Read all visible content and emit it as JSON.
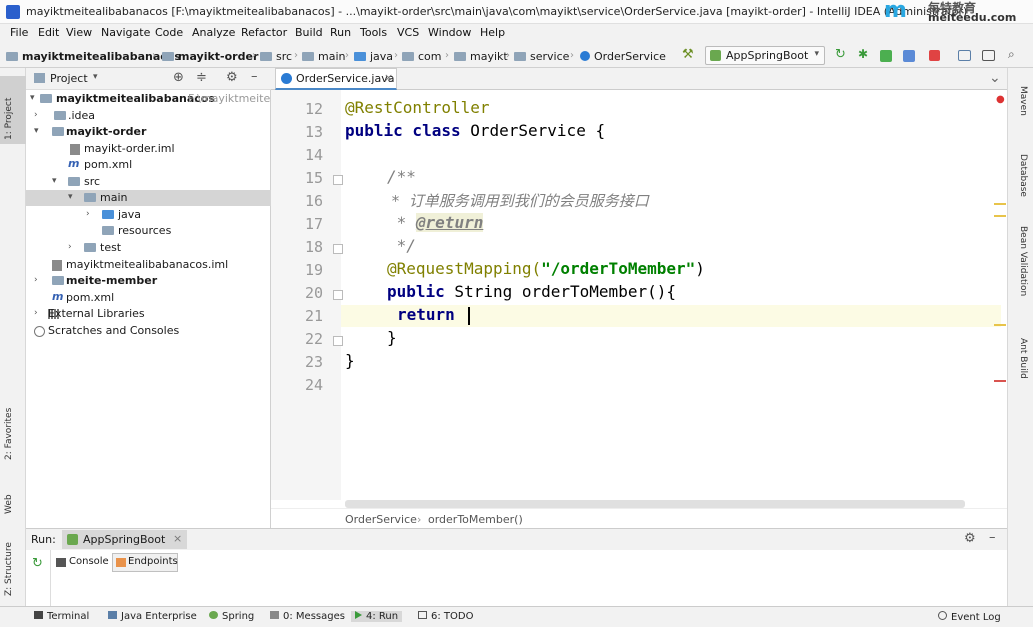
{
  "title_bar": {
    "text": "mayiktmeitealibabanacos [F:\\mayiktmeitealibabanacos] - ...\\mayikt-order\\src\\main\\java\\com\\mayikt\\service\\OrderService.java [mayikt-order] - IntelliJ IDEA (Administrator)",
    "logo_text": "meiteedu.com",
    "logo_cn": "每特教育"
  },
  "menu": [
    "File",
    "Edit",
    "View",
    "Navigate",
    "Code",
    "Analyze",
    "Refactor",
    "Build",
    "Run",
    "Tools",
    "VCS",
    "Window",
    "Help"
  ],
  "breadcrumbs": [
    "mayiktmeitealibabanacos",
    "mayikt-order",
    "src",
    "main",
    "java",
    "com",
    "mayikt",
    "service",
    "OrderService"
  ],
  "run_config": "AppSpringBoot",
  "left_tabs": [
    "1: Project",
    "2: Favorites",
    "Web",
    "Z: Structure"
  ],
  "right_tabs": [
    "Maven",
    "Database",
    "Bean Validation",
    "Ant Build"
  ],
  "project": {
    "header": "Project",
    "tree": [
      {
        "label": "mayiktmeitealibabanacos",
        "suffix": "F:\\mayiktmeiteal",
        "bold": true
      },
      {
        "label": ".idea"
      },
      {
        "label": "mayikt-order",
        "bold": true
      },
      {
        "label": "mayikt-order.iml"
      },
      {
        "label": "pom.xml"
      },
      {
        "label": "src"
      },
      {
        "label": "main"
      },
      {
        "label": "java"
      },
      {
        "label": "resources"
      },
      {
        "label": "test"
      },
      {
        "label": "mayiktmeitealibabanacos.iml"
      },
      {
        "label": "meite-member",
        "bold": true
      },
      {
        "label": "pom.xml"
      },
      {
        "label": "External Libraries"
      },
      {
        "label": "Scratches and Consoles"
      }
    ]
  },
  "editor": {
    "tab": "OrderService.java",
    "line_numbers": [
      "12",
      "13",
      "14",
      "15",
      "16",
      "17",
      "18",
      "19",
      "20",
      "21",
      "22",
      "23",
      "24"
    ],
    "code": {
      "l12": "@RestController",
      "l13_kw": "public class",
      "l13_rest": " OrderService {",
      "l15": "/**",
      "l16": " *  订单服务调用到我们的会员服务接口",
      "l17_star": " * ",
      "l17_tag": "@return",
      "l18": " */",
      "l19_ann": "@RequestMapping(",
      "l19_str": "\"/orderToMember\"",
      "l19_end": ")",
      "l20_kw": "public",
      "l20_rest": " String orderToMember(){",
      "l21": "return",
      "l22": "}",
      "l23": "}"
    },
    "breadcrumb": [
      "OrderService",
      "orderToMember()"
    ]
  },
  "run": {
    "label": "Run:",
    "config": "AppSpringBoot",
    "tabs": [
      "Console",
      "Endpoints"
    ]
  },
  "status_tabs": [
    "Terminal",
    "Java Enterprise",
    "Spring",
    "0: Messages",
    "4: Run",
    "6: TODO"
  ],
  "event_log": "Event Log"
}
